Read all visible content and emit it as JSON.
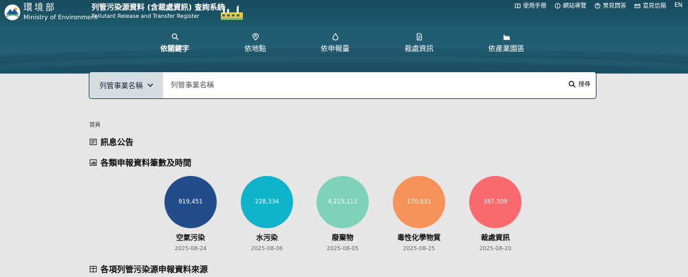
{
  "brand": {
    "ministry_zh": "環境部",
    "ministry_en": "Ministry of Environment",
    "system_zh": "列管污染源資料 (含裁處資訊) 查詢系統",
    "system_en": "Pollutant Release and Transfer Register"
  },
  "topnav": [
    {
      "label": "使用手冊",
      "icon": "manual-icon"
    },
    {
      "label": "網站導覽",
      "icon": "info-icon"
    },
    {
      "label": "常見問答",
      "icon": "question-icon"
    },
    {
      "label": "意見信箱",
      "icon": "mail-icon"
    },
    {
      "label": "EN",
      "icon": ""
    }
  ],
  "mainnav": [
    {
      "label": "依關鍵字",
      "icon": "search-icon",
      "active": true
    },
    {
      "label": "依地點",
      "icon": "location-pin-icon",
      "active": false
    },
    {
      "label": "依申報量",
      "icon": "drop-icon",
      "active": false
    },
    {
      "label": "裁處資訊",
      "icon": "document-icon",
      "active": false
    },
    {
      "label": "依產業園區",
      "icon": "factory-icon",
      "active": false
    }
  ],
  "search": {
    "select_label": "列管事業名稱",
    "placeholder": "列管事業名稱",
    "button_label": "搜尋"
  },
  "breadcrumb": "首頁",
  "sections": {
    "news": "訊息公告",
    "stats": "各類申報資料筆數及時間",
    "sources": "各項列管污染源申報資料來源"
  },
  "stats": [
    {
      "value": "919,451",
      "name": "空氣污染",
      "date": "2025-08-24",
      "color": "#224d8a"
    },
    {
      "value": "228,334",
      "name": "水污染",
      "date": "2025-08-06",
      "color": "#10b3cc"
    },
    {
      "value": "4,215,111",
      "name": "廢棄物",
      "date": "2025-08-05",
      "color": "#7dd2b8"
    },
    {
      "value": "170,631",
      "name": "毒性化學物質",
      "date": "2025-08-25",
      "color": "#f7935a"
    },
    {
      "value": "387,309",
      "name": "裁處資訊",
      "date": "2025-08-20",
      "color": "#f96a6e"
    }
  ]
}
